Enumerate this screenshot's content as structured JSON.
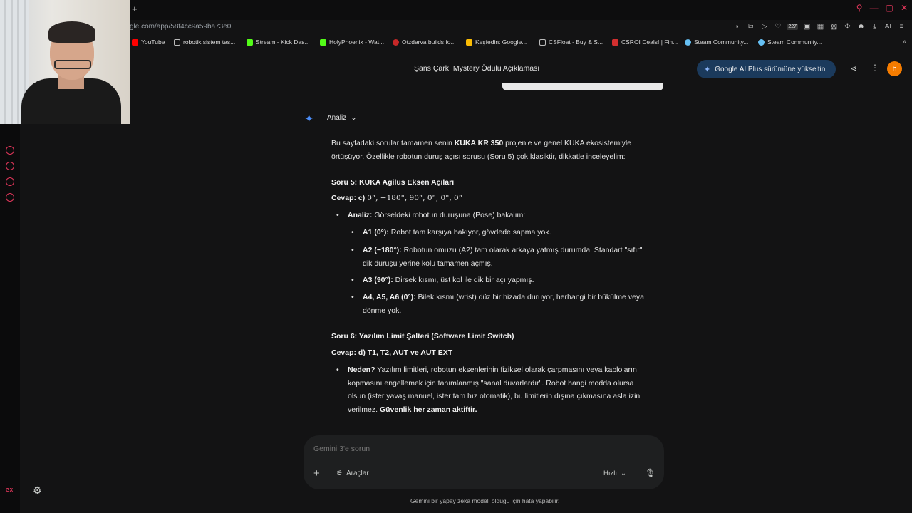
{
  "browser": {
    "url": "gle.com/app/58f4cc9a59ba73e0",
    "extension_badge": "227",
    "ai_label": "AI",
    "bookmarks": [
      {
        "label": "YouTube",
        "color": "#ff0000"
      },
      {
        "label": "robotik sistem tas...",
        "color": "#bbbbbb"
      },
      {
        "label": "Stream - Kick Das...",
        "color": "#53fc18"
      },
      {
        "label": "HolyPhoenix - Wat...",
        "color": "#53fc18"
      },
      {
        "label": "Otzdarva builds fo...",
        "color": "#c62828"
      },
      {
        "label": "Keşfedin: Google...",
        "color": "#fbbc04"
      },
      {
        "label": "CSFloat - Buy & S...",
        "color": "#bbbbbb"
      },
      {
        "label": "CSROI Deals! | Fin...",
        "color": "#d32f2f"
      },
      {
        "label": "Steam Community...",
        "color": "#66c0f4"
      },
      {
        "label": "Steam Community...",
        "color": "#66c0f4"
      }
    ]
  },
  "header": {
    "title": "Şans Çarkı Mystery Ödülü Açıklaması",
    "upgrade_label": "Google AI Plus sürümüne yükseltin",
    "avatar_letter": "h"
  },
  "analysis": {
    "toggle_label": "Analiz"
  },
  "content": {
    "intro_pre": "Bu sayfadaki sorular tamamen senin ",
    "intro_bold": "KUKA KR 350",
    "intro_post": " projenle ve genel KUKA ekosistemiyle",
    "intro_line2": "örtüşüyor. Özellikle robotun duruş açısı sorusu (Soru 5) çok klasiktir, dikkatle inceleyelim:",
    "q5_title": "Soru 5: KUKA Agilus Eksen Açıları",
    "q5_answer_prefix": "Cevap: c) ",
    "q5_answer_math": "0°, −180°, 90°, 0°, 0°, 0°",
    "q5_analysis_label": "Analiz:",
    "q5_analysis_text": " Görseldeki robotun duruşuna (Pose) bakalım:",
    "q5_a1_label": "A1 (0°):",
    "q5_a1_text": " Robot tam karşıya bakıyor, gövdede sapma yok.",
    "q5_a2_label": "A2 (−180°):",
    "q5_a2_text": " Robotun omuzu (A2) tam olarak arkaya yatmış durumda. Standart \"sıfır\"",
    "q5_a2_text2": "dik duruşu yerine kolu tamamen açmış.",
    "q5_a3_label": "A3 (90°):",
    "q5_a3_text": " Dirsek kısmı, üst kol ile dik bir açı yapmış.",
    "q5_a4_label": "A4, A5, A6 (0°):",
    "q5_a4_text": " Bilek kısmı (wrist) düz bir hizada duruyor, herhangi bir bükülme veya",
    "q5_a4_text2": "dönme yok.",
    "q6_title": "Soru 6: Yazılım Limit Şalteri (Software Limit Switch)",
    "q6_answer": "Cevap: d) T1, T2, AUT ve AUT EXT",
    "q6_why_label": "Neden?",
    "q6_why_l1": " Yazılım limitleri, robotun eksenlerinin fiziksel olarak çarpmasını veya kabloların",
    "q6_why_l2": "kopmasını engellemek için tanımlanmış \"sanal duvarlardır\". Robot hangi modda olursa",
    "q6_why_l3": "olsun (ister yavaş manuel, ister tam hız otomatik), bu limitlerin dışına çıkmasına asla izin",
    "q6_why_l4_pre": "verilmez. ",
    "q6_why_l4_bold": "Güvenlik her zaman aktiftir."
  },
  "composer": {
    "placeholder": "Gemini 3'e sorun",
    "tools_label": "Araçlar",
    "mode_label": "Hızlı",
    "disclaimer": "Gemini bir yapay zeka modeli olduğu için hata yapabilir."
  },
  "rail": {
    "gx_label": "GX"
  },
  "icons": [
    "plus-icon",
    "search-icon",
    "minimize-icon",
    "maximize-icon",
    "close-icon",
    "share-icon",
    "more-vert-icon",
    "spark-icon",
    "chevron-down-icon",
    "mic-icon",
    "settings-icon",
    "tools-icon"
  ],
  "colors": {
    "accent": "#4b8df8",
    "upgrade_bg": "#1b3a5c",
    "avatar": "#f57c00",
    "opera_red": "#e0365a"
  }
}
